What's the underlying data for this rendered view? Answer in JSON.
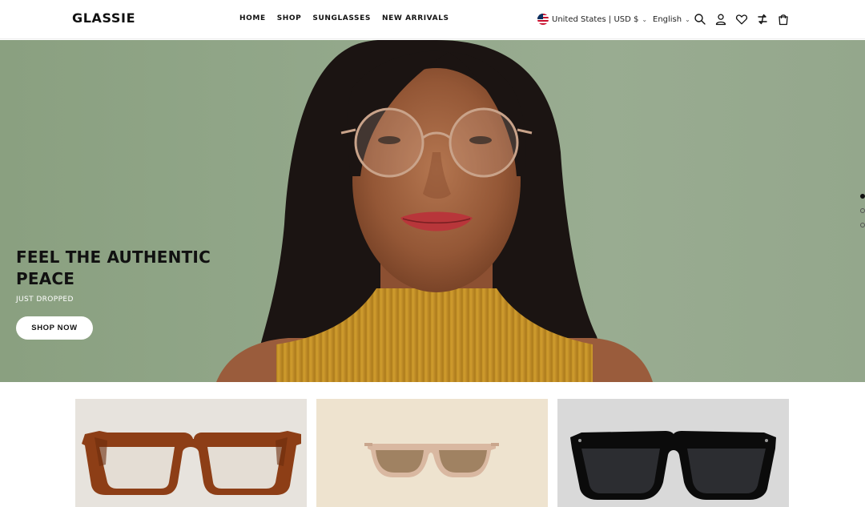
{
  "header": {
    "logo": "GLASSIE",
    "nav": [
      "HOME",
      "SHOP",
      "SUNGLASSES",
      "NEW ARRIVALS"
    ],
    "locale": "United States | USD $",
    "language": "English",
    "icons": [
      "search-icon",
      "account-icon",
      "wishlist-icon",
      "compare-icon",
      "cart-icon"
    ]
  },
  "hero": {
    "title": "FEEL THE AUTHENTIC PEACE",
    "subtitle": "JUST DROPPED",
    "button": "SHOP NOW",
    "slides": 3,
    "active_slide": 1
  },
  "products": [
    {
      "name": "tortoise-eyeglasses",
      "background": "#e7e3dd"
    },
    {
      "name": "clear-sunglasses",
      "background": "#eee3cf"
    },
    {
      "name": "black-sunglasses",
      "background": "#d9d9d9"
    }
  ],
  "colors": {
    "hero_background": "#93a88b",
    "text": "#111111"
  }
}
